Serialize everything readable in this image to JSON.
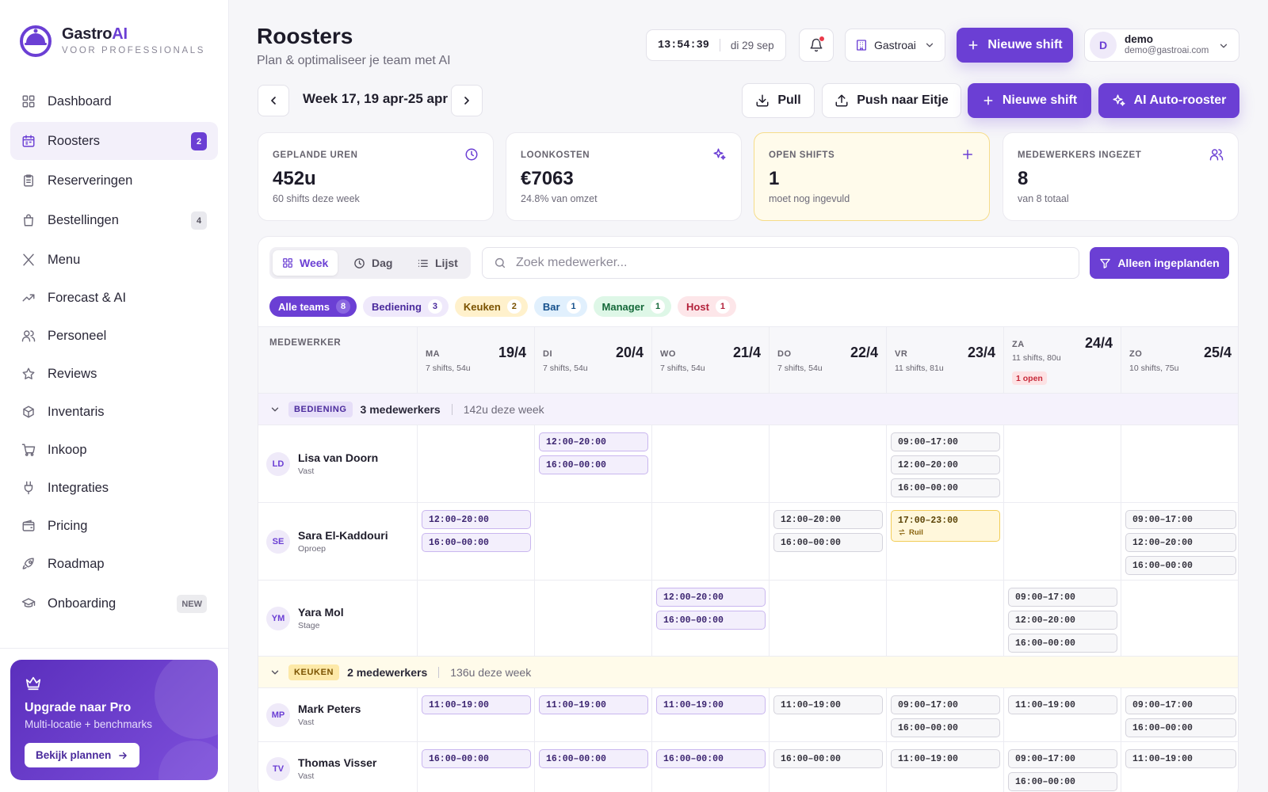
{
  "brand": {
    "name_main": "Gastro",
    "name_accent": "AI",
    "tagline": "VOOR PROFESSIONALS"
  },
  "nav": [
    {
      "label": "Dashboard",
      "icon": "dashboard-icon",
      "badge": ""
    },
    {
      "label": "Roosters",
      "icon": "calendar-icon",
      "badge": "2",
      "active": true
    },
    {
      "label": "Reserveringen",
      "icon": "clipboard-icon",
      "badge": ""
    },
    {
      "label": "Bestellingen",
      "icon": "bag-icon",
      "badge": "4"
    },
    {
      "label": "Menu",
      "icon": "utensils-icon",
      "badge": ""
    },
    {
      "label": "Forecast & AI",
      "icon": "trend-icon",
      "badge": ""
    },
    {
      "label": "Personeel",
      "icon": "users-icon",
      "badge": ""
    },
    {
      "label": "Reviews",
      "icon": "star-icon",
      "badge": ""
    },
    {
      "label": "Inventaris",
      "icon": "box-icon",
      "badge": ""
    },
    {
      "label": "Inkoop",
      "icon": "cart-icon",
      "badge": ""
    },
    {
      "label": "Integraties",
      "icon": "plug-icon",
      "badge": ""
    },
    {
      "label": "Pricing",
      "icon": "wallet-icon",
      "badge": ""
    },
    {
      "label": "Roadmap",
      "icon": "rocket-icon",
      "badge": ""
    },
    {
      "label": "Onboarding",
      "icon": "graduation-icon",
      "badge": "NEW"
    }
  ],
  "promo": {
    "title": "Upgrade naar Pro",
    "subtitle": "Multi-locatie + benchmarks",
    "button": "Bekijk plannen"
  },
  "header": {
    "title": "Roosters",
    "subtitle": "Plan & optimaliseer je team met AI",
    "time": "13:54:39",
    "date": "di 29 sep",
    "location": "Gastroai",
    "new_shift": "Nieuwe shift",
    "user_initial": "D",
    "user_name": "demo",
    "user_email": "demo@gastroai.com"
  },
  "toolbar": {
    "week_label": "Week 17, 19 apr-25 apr",
    "pull": "Pull",
    "push": "Push naar Eitje",
    "new_shift": "Nieuwe shift",
    "auto": "AI Auto-rooster"
  },
  "stats": [
    {
      "label": "GEPLANDE UREN",
      "value": "452u",
      "sub": "60 shifts deze week",
      "icon": "clock-icon"
    },
    {
      "label": "LOONKOSTEN",
      "value": "€7063",
      "sub": "24.8% van omzet",
      "icon": "sparkle-icon"
    },
    {
      "label": "OPEN SHIFTS",
      "value": "1",
      "sub": "moet nog ingevuld",
      "icon": "plus-icon"
    },
    {
      "label": "MEDEWERKERS INGEZET",
      "value": "8",
      "sub": "van 8 totaal",
      "icon": "users-icon"
    }
  ],
  "views": {
    "week": "Week",
    "day": "Dag",
    "list": "Lijst"
  },
  "search": {
    "placeholder": "Zoek medewerker..."
  },
  "filter": {
    "label": "Alleen ingeplanden"
  },
  "chips": [
    {
      "label": "Alle teams",
      "count": "8",
      "bg": "#6b3fd4",
      "fg": "#ffffff",
      "cbg": "#8a67e0",
      "cfg": "#ffffff"
    },
    {
      "label": "Bediening",
      "count": "3",
      "bg": "#efe9fb",
      "fg": "#4a2a9c",
      "cbg": "#ffffff",
      "cfg": "#4a2a9c"
    },
    {
      "label": "Keuken",
      "count": "2",
      "bg": "#fff1cc",
      "fg": "#7a5200",
      "cbg": "#ffffff",
      "cfg": "#7a5200"
    },
    {
      "label": "Bar",
      "count": "1",
      "bg": "#e1f0fd",
      "fg": "#14508c",
      "cbg": "#ffffff",
      "cfg": "#14508c"
    },
    {
      "label": "Manager",
      "count": "1",
      "bg": "#def7e7",
      "fg": "#15693a",
      "cbg": "#ffffff",
      "cfg": "#15693a"
    },
    {
      "label": "Host",
      "count": "1",
      "bg": "#fde6e9",
      "fg": "#b3223b",
      "cbg": "#ffffff",
      "cfg": "#b3223b"
    }
  ],
  "grid": {
    "employee_header": "MEDEWERKER",
    "days": [
      {
        "short": "MA",
        "num": "19/4",
        "meta": "7 shifts, 54u",
        "open": ""
      },
      {
        "short": "DI",
        "num": "20/4",
        "meta": "7 shifts, 54u",
        "open": ""
      },
      {
        "short": "WO",
        "num": "21/4",
        "meta": "7 shifts, 54u",
        "open": ""
      },
      {
        "short": "DO",
        "num": "22/4",
        "meta": "7 shifts, 54u",
        "open": ""
      },
      {
        "short": "VR",
        "num": "23/4",
        "meta": "11 shifts, 81u",
        "open": ""
      },
      {
        "short": "ZA",
        "num": "24/4",
        "meta": "11 shifts, 80u",
        "open": "1 open"
      },
      {
        "short": "ZO",
        "num": "25/4",
        "meta": "10 shifts, 75u",
        "open": ""
      }
    ],
    "groups": [
      {
        "tag": "BEDIENING",
        "tag_bg": "#e6def8",
        "tag_fg": "#4a2a9c",
        "row_bg": "#f5f2fc",
        "count": "3 medewerkers",
        "hours": "142u deze week",
        "employees": [
          {
            "initials": "LD",
            "name": "Lisa van Doorn",
            "type": "Vast",
            "days": [
              [],
              [
                {
                  "t": "12:00–20:00",
                  "c": "purple"
                },
                {
                  "t": "16:00–00:00",
                  "c": "purple"
                }
              ],
              [],
              [],
              [
                {
                  "t": "09:00–17:00",
                  "c": "gray"
                },
                {
                  "t": "12:00–20:00",
                  "c": "gray"
                },
                {
                  "t": "16:00–00:00",
                  "c": "gray"
                }
              ],
              [],
              []
            ]
          },
          {
            "initials": "SE",
            "name": "Sara El-Kaddouri",
            "type": "Oproep",
            "days": [
              [
                {
                  "t": "12:00–20:00",
                  "c": "purple"
                },
                {
                  "t": "16:00–00:00",
                  "c": "purple"
                }
              ],
              [],
              [],
              [
                {
                  "t": "12:00–20:00",
                  "c": "gray"
                },
                {
                  "t": "16:00–00:00",
                  "c": "gray"
                }
              ],
              [
                {
                  "t": "17:00–23:00",
                  "c": "swap",
                  "note": "Ruil"
                }
              ],
              [],
              [
                {
                  "t": "09:00–17:00",
                  "c": "gray"
                },
                {
                  "t": "12:00–20:00",
                  "c": "gray"
                },
                {
                  "t": "16:00–00:00",
                  "c": "gray"
                }
              ]
            ]
          },
          {
            "initials": "YM",
            "name": "Yara Mol",
            "type": "Stage",
            "days": [
              [],
              [],
              [
                {
                  "t": "12:00–20:00",
                  "c": "purple"
                },
                {
                  "t": "16:00–00:00",
                  "c": "purple"
                }
              ],
              [],
              [],
              [
                {
                  "t": "09:00–17:00",
                  "c": "gray"
                },
                {
                  "t": "12:00–20:00",
                  "c": "gray"
                },
                {
                  "t": "16:00–00:00",
                  "c": "gray"
                }
              ],
              []
            ]
          }
        ]
      },
      {
        "tag": "KEUKEN",
        "tag_bg": "#fde9a8",
        "tag_fg": "#7a5200",
        "row_bg": "#fffbea",
        "count": "2 medewerkers",
        "hours": "136u deze week",
        "employees": [
          {
            "initials": "MP",
            "name": "Mark Peters",
            "type": "Vast",
            "days": [
              [
                {
                  "t": "11:00–19:00",
                  "c": "purple"
                }
              ],
              [
                {
                  "t": "11:00–19:00",
                  "c": "purple"
                }
              ],
              [
                {
                  "t": "11:00–19:00",
                  "c": "purple"
                }
              ],
              [
                {
                  "t": "11:00–19:00",
                  "c": "gray"
                }
              ],
              [
                {
                  "t": "09:00–17:00",
                  "c": "gray"
                },
                {
                  "t": "16:00–00:00",
                  "c": "gray"
                }
              ],
              [
                {
                  "t": "11:00–19:00",
                  "c": "gray"
                }
              ],
              [
                {
                  "t": "09:00–17:00",
                  "c": "gray"
                },
                {
                  "t": "16:00–00:00",
                  "c": "gray"
                }
              ]
            ]
          },
          {
            "initials": "TV",
            "name": "Thomas Visser",
            "type": "Vast",
            "days": [
              [
                {
                  "t": "16:00–00:00",
                  "c": "purple"
                }
              ],
              [
                {
                  "t": "16:00–00:00",
                  "c": "purple"
                }
              ],
              [
                {
                  "t": "16:00–00:00",
                  "c": "purple"
                }
              ],
              [
                {
                  "t": "16:00–00:00",
                  "c": "gray"
                }
              ],
              [
                {
                  "t": "11:00–19:00",
                  "c": "gray"
                }
              ],
              [
                {
                  "t": "09:00–17:00",
                  "c": "gray"
                },
                {
                  "t": "16:00–00:00",
                  "c": "gray"
                }
              ],
              [
                {
                  "t": "11:00–19:00",
                  "c": "gray"
                }
              ]
            ]
          }
        ]
      }
    ]
  }
}
